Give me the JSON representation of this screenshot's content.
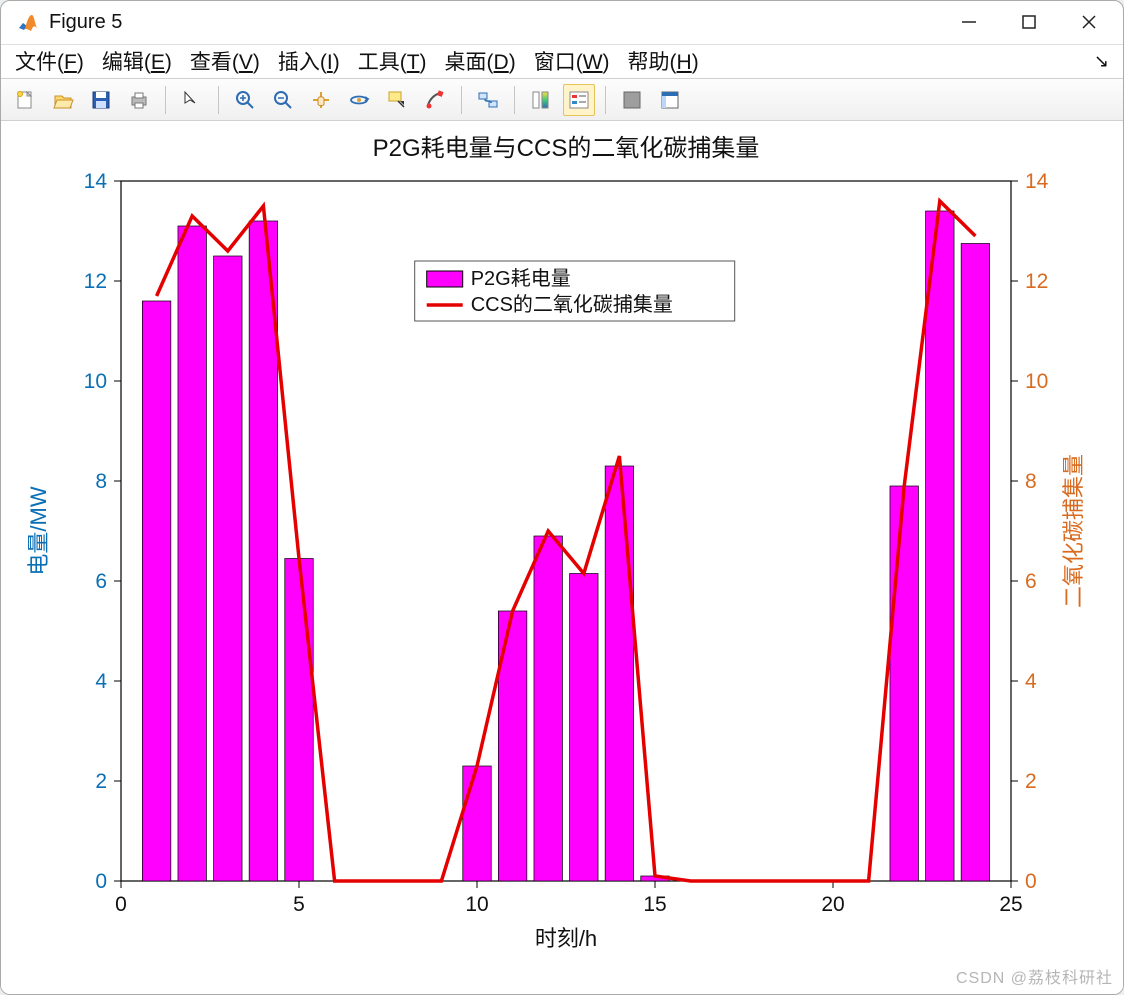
{
  "window": {
    "title": "Figure 5"
  },
  "menu": {
    "file": "文件(F)",
    "edit": "编辑(E)",
    "view": "查看(V)",
    "insert": "插入(I)",
    "tools": "工具(T)",
    "desktop": "桌面(D)",
    "window": "窗口(W)",
    "help": "帮助(H)"
  },
  "watermark": "CSDN @荔枝科研社",
  "chart_data": {
    "type": "bar+line",
    "title": "P2G耗电量与CCS的二氧化碳捕集量",
    "xlabel": "时刻/h",
    "ylabel_left": "电量/MW",
    "ylabel_right": "二氧化碳捕集量",
    "xlim": [
      0,
      25
    ],
    "ylim_left": [
      0,
      14
    ],
    "ylim_right": [
      0,
      14
    ],
    "xticks": [
      0,
      5,
      10,
      15,
      20,
      25
    ],
    "yticks_left": [
      0,
      2,
      4,
      6,
      8,
      10,
      12,
      14
    ],
    "yticks_right": [
      0,
      2,
      4,
      6,
      8,
      10,
      12,
      14
    ],
    "x": [
      1,
      2,
      3,
      4,
      5,
      6,
      7,
      8,
      9,
      10,
      11,
      12,
      13,
      14,
      15,
      16,
      17,
      18,
      19,
      20,
      21,
      22,
      23,
      24
    ],
    "series": [
      {
        "name": "P2G耗电量",
        "kind": "bar",
        "axis": "left",
        "color": "#ff00ff",
        "values": [
          11.6,
          13.1,
          12.5,
          13.2,
          6.45,
          0,
          0,
          0,
          0,
          2.3,
          5.4,
          6.9,
          6.15,
          8.3,
          0.1,
          0,
          0,
          0,
          0,
          0,
          0,
          7.9,
          13.4,
          12.75
        ]
      },
      {
        "name": "CCS的二氧化碳捕集量",
        "kind": "line",
        "axis": "right",
        "color": "#e50000",
        "values": [
          11.7,
          13.3,
          12.6,
          13.5,
          6.45,
          0,
          0,
          0,
          0,
          2.3,
          5.4,
          7.0,
          6.15,
          8.5,
          0.1,
          0,
          0,
          0,
          0,
          0,
          0,
          7.9,
          13.6,
          12.9
        ]
      }
    ],
    "legend": {
      "entries": [
        "P2G耗电量",
        "CCS的二氧化碳捕集量"
      ]
    }
  }
}
